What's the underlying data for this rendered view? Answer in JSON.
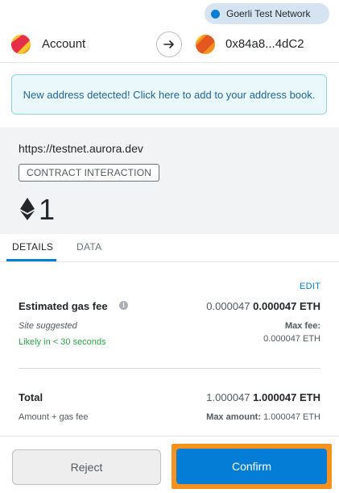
{
  "network": {
    "label": "Goerli Test Network",
    "dot_color": "#037dd6"
  },
  "accounts": {
    "from_name": "Account",
    "to_address": "0x84a8...4dC2",
    "arrow_icon": "arrow-right-icon"
  },
  "banner": {
    "text": "New address detected! Click here to add to your address book."
  },
  "origin": {
    "url": "https://testnet.aurora.dev",
    "badge": "CONTRACT INTERACTION",
    "amount": "1",
    "amount_icon": "eth-icon"
  },
  "tabs": [
    {
      "label": "DETAILS",
      "active": true
    },
    {
      "label": "DATA",
      "active": false
    }
  ],
  "details": {
    "edit_label": "EDIT",
    "gas_fee_label": "Estimated gas fee",
    "gas_fee_secondary": "0.000047",
    "gas_fee_primary": "0.000047 ETH",
    "site_suggested": "Site suggested",
    "likely_time": "Likely in < 30 seconds",
    "max_fee_label": "Max fee:",
    "max_fee_value": "0.000047 ETH",
    "total_label": "Total",
    "total_secondary": "1.000047",
    "total_primary": "1.000047 ETH",
    "amount_gas_label": "Amount + gas fee",
    "max_amount_label": "Max amount:",
    "max_amount_value": "1.000047 ETH"
  },
  "footer": {
    "reject_label": "Reject",
    "confirm_label": "Confirm",
    "accent": "#037dd6",
    "highlight": "#f5921e"
  }
}
